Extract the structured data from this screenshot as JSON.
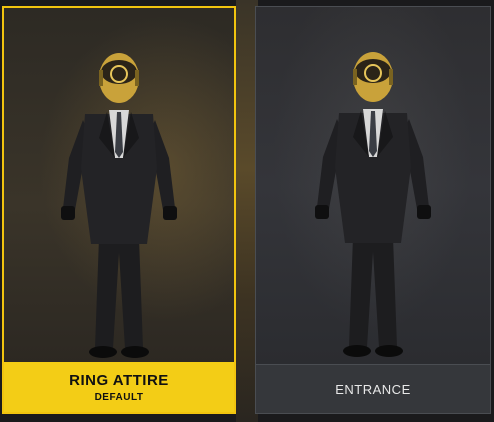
{
  "cards": [
    {
      "title": "RING ATTIRE",
      "subtitle": "DEFAULT",
      "selected": true
    },
    {
      "title": "ENTRANCE",
      "subtitle": "",
      "selected": false
    }
  ],
  "colors": {
    "selected_accent": "#f3cd16",
    "card_border": "#4a4d52",
    "background": "#1a1a1c"
  },
  "icons": [
    "character-model",
    "character-model"
  ]
}
